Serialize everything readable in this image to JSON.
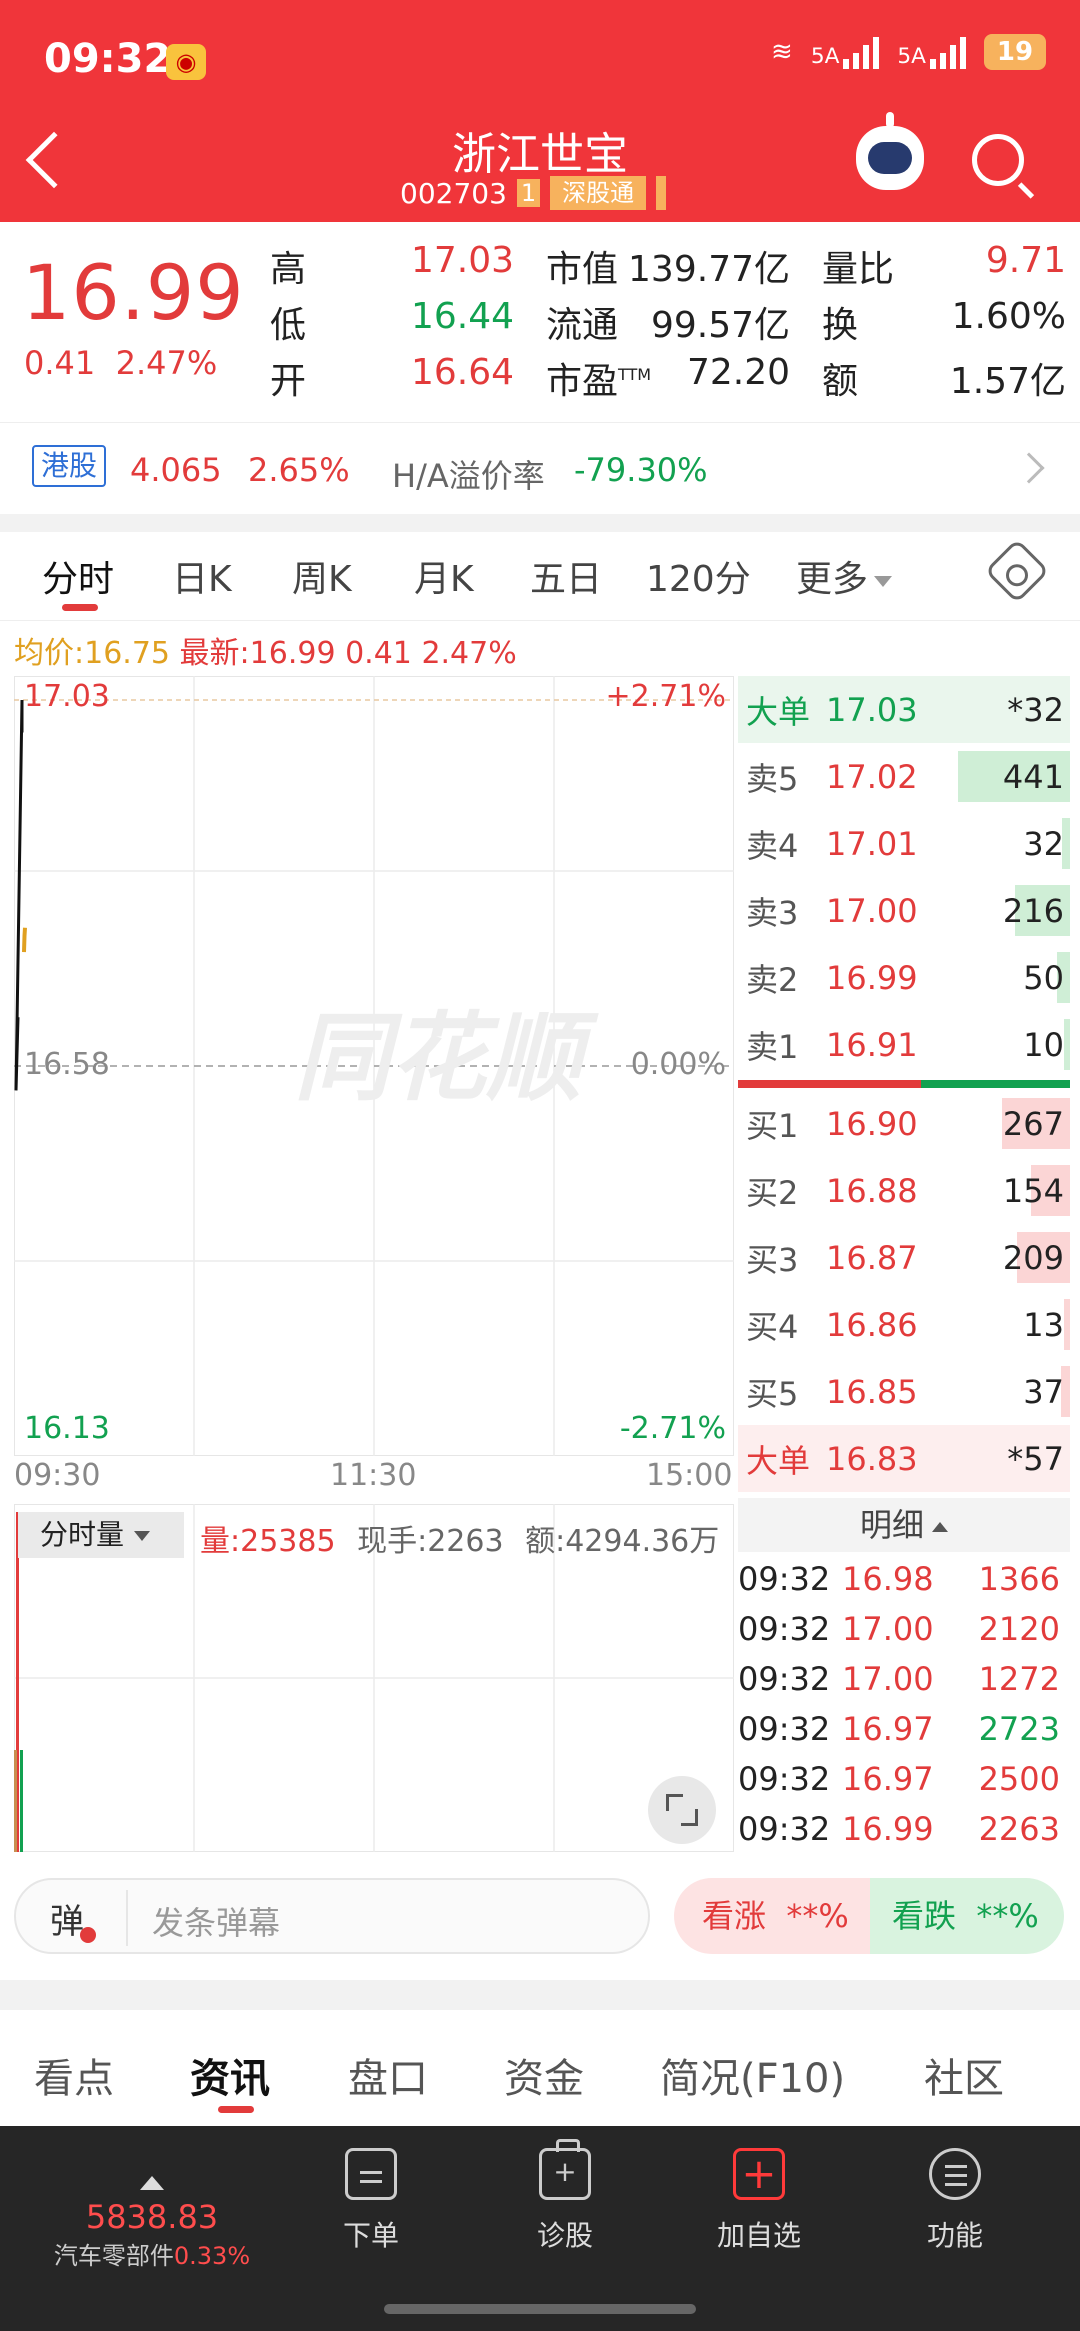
{
  "status": {
    "time": "09:32",
    "battery": "19",
    "net1": "5A",
    "net2": "5A"
  },
  "header": {
    "title": "浙江世宝",
    "code": "002703",
    "tag_num": "1",
    "tag_exchange": "深股通"
  },
  "quote": {
    "price": "16.99",
    "change": "0.41",
    "change_pct": "2.47%",
    "cols": [
      [
        {
          "label": "高",
          "value": "17.03",
          "color": "#e23b3b"
        },
        {
          "label": "低",
          "value": "16.44",
          "color": "#12a150"
        },
        {
          "label": "开",
          "value": "16.64",
          "color": "#e23b3b"
        }
      ],
      [
        {
          "label": "市值",
          "value": "139.77亿",
          "color": "#222"
        },
        {
          "label": "流通",
          "value": "99.57亿",
          "color": "#222"
        },
        {
          "label": "市盈",
          "sup": "TTM",
          "value": "72.20",
          "color": "#222"
        }
      ],
      [
        {
          "label": "量比",
          "value": "9.71",
          "color": "#e23b3b"
        },
        {
          "label": "换",
          "value": "1.60%",
          "color": "#222"
        },
        {
          "label": "额",
          "value": "1.57亿",
          "color": "#222"
        }
      ]
    ]
  },
  "hk": {
    "badge": "港股",
    "price": "4.065",
    "pct": "2.65%",
    "premium_label": "H/A溢价率",
    "premium": "-79.30%"
  },
  "tabs": [
    "分时",
    "日K",
    "周K",
    "月K",
    "五日",
    "120分",
    "更多"
  ],
  "avg": {
    "avg_label": "均价:16.75",
    "latest_label": "最新:16.99",
    "chg": "0.41",
    "pct": "2.47%"
  },
  "chart_data": {
    "type": "line",
    "title": "",
    "x_ticks": [
      "09:30",
      "11:30",
      "15:00"
    ],
    "y_max": "17.03",
    "y_mid": "16.58",
    "y_min": "16.13",
    "pct_max": "+2.71%",
    "pct_mid": "0.00%",
    "pct_min": "-2.71%",
    "ylim": [
      16.13,
      17.03
    ],
    "series": [
      {
        "values": [
          16.64,
          16.55,
          17.03,
          16.99
        ]
      }
    ],
    "avg_series": [
      {
        "values": [
          16.72,
          16.74,
          16.75
        ]
      }
    ],
    "volume": [
      {
        "values": [
          1.0,
          0.3
        ]
      }
    ]
  },
  "book": {
    "top": {
      "label": "大单",
      "price": "17.03",
      "vol": "*32"
    },
    "asks": [
      {
        "label": "卖5",
        "price": "17.02",
        "vol": "441",
        "size": 441
      },
      {
        "label": "卖4",
        "price": "17.01",
        "vol": "32",
        "size": 32
      },
      {
        "label": "卖3",
        "price": "17.00",
        "vol": "216",
        "size": 216
      },
      {
        "label": "卖2",
        "price": "16.99",
        "vol": "50",
        "size": 50
      },
      {
        "label": "卖1",
        "price": "16.91",
        "vol": "10",
        "size": 10
      }
    ],
    "bids": [
      {
        "label": "买1",
        "price": "16.90",
        "vol": "267",
        "size": 267
      },
      {
        "label": "买2",
        "price": "16.88",
        "vol": "154",
        "size": 154
      },
      {
        "label": "买3",
        "price": "16.87",
        "vol": "209",
        "size": 209
      },
      {
        "label": "买4",
        "price": "16.86",
        "vol": "13",
        "size": 13
      },
      {
        "label": "买5",
        "price": "16.85",
        "vol": "37",
        "size": 37
      }
    ],
    "bottom": {
      "label": "大单",
      "price": "16.83",
      "vol": "*57"
    }
  },
  "volume": {
    "selector": "分时量",
    "vol": "量:25385",
    "now": "现手:2263",
    "amount": "额:4294.36万"
  },
  "detail": {
    "head": "明细",
    "rows": [
      {
        "t": "09:32",
        "p": "16.98",
        "v": "1366",
        "c": "#e23b3b"
      },
      {
        "t": "09:32",
        "p": "17.00",
        "v": "2120",
        "c": "#e23b3b"
      },
      {
        "t": "09:32",
        "p": "17.00",
        "v": "1272",
        "c": "#e23b3b"
      },
      {
        "t": "09:32",
        "p": "16.97",
        "v": "2723",
        "c": "#12a150"
      },
      {
        "t": "09:32",
        "p": "16.97",
        "v": "2500",
        "c": "#e23b3b"
      },
      {
        "t": "09:32",
        "p": "16.99",
        "v": "2263",
        "c": "#e23b3b"
      }
    ]
  },
  "barrage": {
    "btn": "弹",
    "placeholder": "发条弹幕",
    "up": "看涨",
    "up_pct": "**%",
    "down": "看跌",
    "down_pct": "**%"
  },
  "bottom_tabs": [
    "看点",
    "资讯",
    "盘口",
    "资金",
    "简况(F10)",
    "社区"
  ],
  "nav": {
    "index_value": "5838.83",
    "index_name": "汽车零部件",
    "index_pct": "0.33%",
    "items": [
      "下单",
      "诊股",
      "加自选",
      "功能"
    ]
  },
  "watermark": "同花顺"
}
